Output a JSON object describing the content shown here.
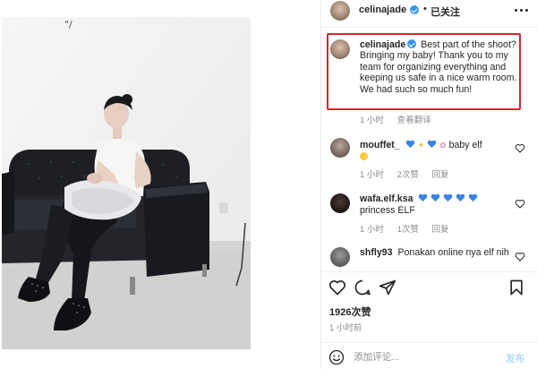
{
  "post": {
    "username": "celinajade",
    "follow_dot": "•",
    "follow_label": "已关注",
    "caption": "Best part of the shoot? Bringing my baby! Thank you to my team for organizing everything and keeping us safe in a nice warm room. We had such so much fun!",
    "caption_time": "1 小时",
    "caption_view_translation": "查看翻译",
    "likes": "1926次赞",
    "timestamp": "1 小时前"
  },
  "photo": {
    "corner_mark": "\"/"
  },
  "comments": [
    {
      "username": "mouffet_",
      "text": "baby elf",
      "time": "1 小时",
      "likes": "2次赞",
      "reply": "回复"
    },
    {
      "username": "wafa.elf.ksa",
      "text": "princess ELF",
      "time": "1 小时",
      "likes": "1次赞",
      "reply": "回复"
    },
    {
      "username": "shfly93",
      "text": "Ponakan online nya elf nih",
      "time": "",
      "likes": "",
      "reply": ""
    }
  ],
  "composer": {
    "placeholder": "添加评论...",
    "post_label": "发布"
  },
  "colors": {
    "highlight_box": "#d7262b",
    "verified": "#3897f0",
    "post_button": "#b3dbff",
    "emoji_heart": "#3b83e6"
  }
}
